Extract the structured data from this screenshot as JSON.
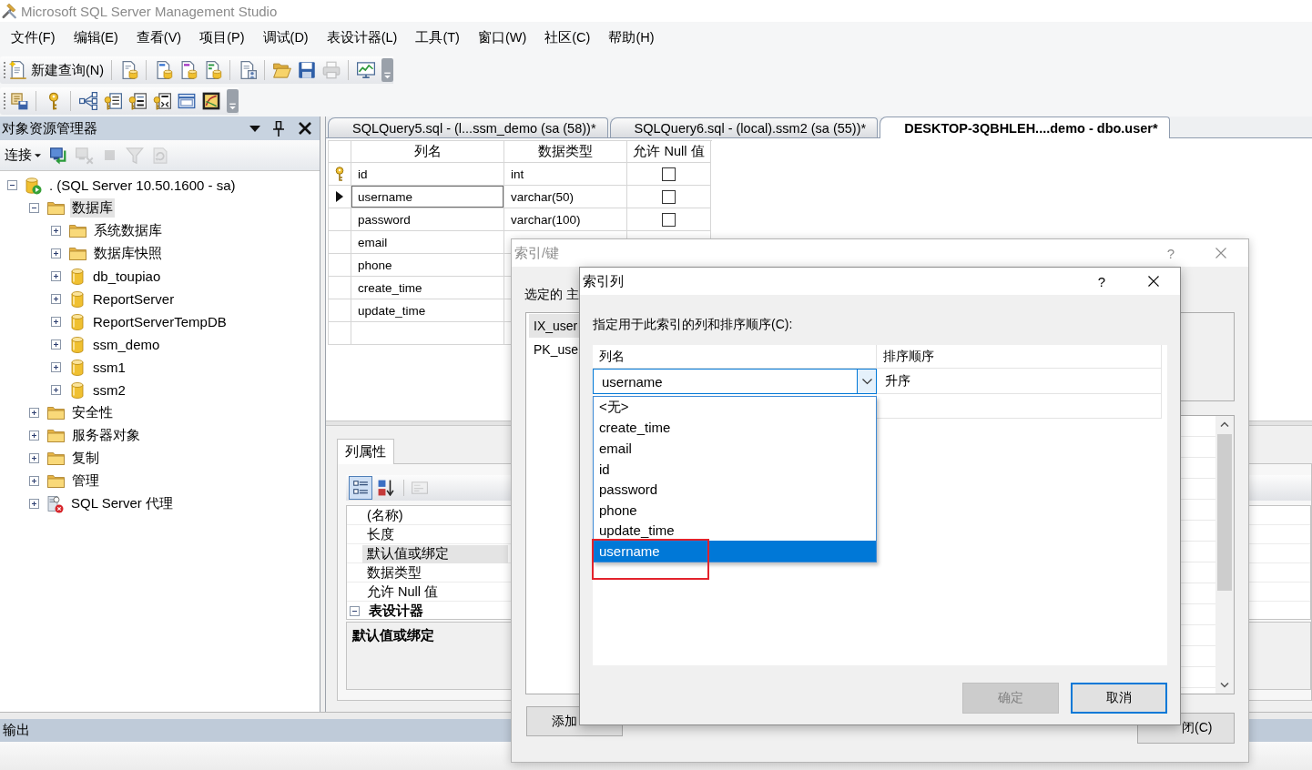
{
  "window": {
    "title": "Microsoft SQL Server Management Studio"
  },
  "menu": [
    "文件(F)",
    "编辑(E)",
    "查看(V)",
    "项目(P)",
    "调试(D)",
    "表设计器(L)",
    "工具(T)",
    "窗口(W)",
    "社区(C)",
    "帮助(H)"
  ],
  "toolbars": [
    [
      [
        {
          "kind": "new-query",
          "label": "新建查询(N)",
          "disabled": false
        }
      ],
      [
        {
          "kind": "database-query",
          "disabled": false
        }
      ],
      [
        {
          "kind": "mdx-query",
          "disabled": false
        },
        {
          "kind": "dmx-query",
          "disabled": false
        },
        {
          "kind": "xmla-query",
          "disabled": false
        }
      ],
      [
        {
          "kind": "template",
          "disabled": false
        }
      ],
      [
        {
          "kind": "open",
          "disabled": false
        },
        {
          "kind": "save",
          "disabled": false
        },
        {
          "kind": "print",
          "disabled": true
        }
      ],
      [
        {
          "kind": "activity-monitor",
          "disabled": false
        }
      ]
    ],
    [
      [
        {
          "kind": "generate-script",
          "disabled": false
        }
      ],
      [
        {
          "kind": "primary-key",
          "disabled": false
        }
      ],
      [
        {
          "kind": "relationships",
          "disabled": false
        },
        {
          "kind": "indexes",
          "disabled": false
        },
        {
          "kind": "fulltext-index",
          "disabled": false
        },
        {
          "kind": "xml-index",
          "disabled": false
        },
        {
          "kind": "check-constraints",
          "disabled": false
        },
        {
          "kind": "spatial-index",
          "disabled": false
        }
      ]
    ]
  ],
  "object_explorer": {
    "title": "对象资源管理器",
    "connect": "连接",
    "tools": [
      {
        "kind": "connect",
        "disabled": false
      },
      {
        "kind": "disconnect",
        "disabled": true
      },
      {
        "kind": "stop",
        "disabled": true
      },
      {
        "kind": "filter",
        "disabled": true
      },
      {
        "kind": "refresh",
        "disabled": true
      }
    ],
    "tree": [
      {
        "label": ". (SQL Server 10.50.1600 - sa)",
        "kind": "server",
        "expanded": true,
        "selected": false,
        "children": [
          {
            "label": "数据库",
            "kind": "folder",
            "expanded": true,
            "selected": true,
            "children": [
              {
                "label": "系统数据库",
                "kind": "folder",
                "expanded": false,
                "selected": false
              },
              {
                "label": "数据库快照",
                "kind": "folder",
                "expanded": false,
                "selected": false
              },
              {
                "label": "db_toupiao",
                "kind": "database",
                "expanded": false,
                "selected": false
              },
              {
                "label": "ReportServer",
                "kind": "database",
                "expanded": false,
                "selected": false
              },
              {
                "label": "ReportServerTempDB",
                "kind": "database",
                "expanded": false,
                "selected": false
              },
              {
                "label": "ssm_demo",
                "kind": "database",
                "expanded": false,
                "selected": false
              },
              {
                "label": "ssm1",
                "kind": "database",
                "expanded": false,
                "selected": false
              },
              {
                "label": "ssm2",
                "kind": "database",
                "expanded": false,
                "selected": false
              }
            ]
          },
          {
            "label": "安全性",
            "kind": "folder",
            "expanded": false,
            "selected": false
          },
          {
            "label": "服务器对象",
            "kind": "folder",
            "expanded": false,
            "selected": false
          },
          {
            "label": "复制",
            "kind": "folder",
            "expanded": false,
            "selected": false
          },
          {
            "label": "管理",
            "kind": "folder",
            "expanded": false,
            "selected": false
          },
          {
            "label": "SQL Server 代理",
            "kind": "agent",
            "expanded": false,
            "selected": false
          }
        ]
      }
    ]
  },
  "tabs": [
    {
      "label": "SQLQuery5.sql - (l...ssm_demo (sa (58))*",
      "selected": false
    },
    {
      "label": "SQLQuery6.sql - (local).ssm2 (sa (55))*",
      "selected": false
    },
    {
      "label": "DESKTOP-3QBHLEH....demo - dbo.user*",
      "selected": true
    }
  ],
  "designer": {
    "columns": [
      "列名",
      "数据类型",
      "允许 Null 值"
    ],
    "rows": [
      {
        "name": "id",
        "type": "int",
        "allow_null": false,
        "primary_key": true,
        "selected": false
      },
      {
        "name": "username",
        "type": "varchar(50)",
        "allow_null": false,
        "primary_key": false,
        "selected": true
      },
      {
        "name": "password",
        "type": "varchar(100)",
        "allow_null": false,
        "primary_key": false,
        "selected": false
      },
      {
        "name": "email",
        "primary_key": false,
        "selected": false
      },
      {
        "name": "phone",
        "primary_key": false,
        "selected": false
      },
      {
        "name": "create_time",
        "primary_key": false,
        "selected": false
      },
      {
        "name": "update_time",
        "primary_key": false,
        "selected": false
      }
    ]
  },
  "column_properties": {
    "tab": "列属性",
    "tools": [
      {
        "kind": "categorized",
        "selected": true,
        "disabled": false
      },
      {
        "kind": "alphabetical",
        "selected": false,
        "disabled": false
      },
      {
        "kind": "property-pages",
        "selected": false,
        "disabled": true
      }
    ],
    "rows": [
      {
        "kind": "property",
        "label": "(名称)",
        "selected": false
      },
      {
        "kind": "property",
        "label": "长度",
        "selected": false
      },
      {
        "kind": "property",
        "label": "默认值或绑定",
        "selected": true
      },
      {
        "kind": "property",
        "label": "数据类型",
        "selected": false
      },
      {
        "kind": "property",
        "label": "允许 Null 值",
        "selected": false
      },
      {
        "kind": "category",
        "label": "表设计器",
        "expanded": true,
        "selected": false
      }
    ],
    "description": "默认值或绑定"
  },
  "output": {
    "title": "输出"
  },
  "index_keys_dialog": {
    "title": "索引/键",
    "help": "?",
    "active": false,
    "list_label": "选定的 主",
    "items": [
      {
        "label": "IX_user",
        "selected": true
      },
      {
        "label": "PK_use",
        "selected": false
      }
    ],
    "buttons": [
      {
        "kind": "add",
        "label": "添加"
      },
      {
        "kind": "close",
        "label": "闭(C)"
      }
    ]
  },
  "index_columns_dialog": {
    "title": "索引列",
    "help": "?",
    "active": true,
    "instruction": "指定用于此索引的列和排序顺序(C):",
    "columns": [
      "列名",
      "排序顺序"
    ],
    "rows": [
      {
        "column": "username",
        "order": "升序"
      }
    ],
    "dropdown": {
      "items": [
        {
          "label": "<无>",
          "selected": false
        },
        {
          "label": "create_time",
          "selected": false
        },
        {
          "label": "email",
          "selected": false
        },
        {
          "label": "id",
          "selected": false
        },
        {
          "label": "password",
          "selected": false
        },
        {
          "label": "phone",
          "selected": false
        },
        {
          "label": "update_time",
          "selected": false
        },
        {
          "label": "username",
          "selected": true
        }
      ],
      "annotation_frame": true
    },
    "buttons": [
      {
        "label": "确定",
        "disabled": true,
        "default": false
      },
      {
        "label": "取消",
        "disabled": false,
        "default": true
      }
    ]
  }
}
